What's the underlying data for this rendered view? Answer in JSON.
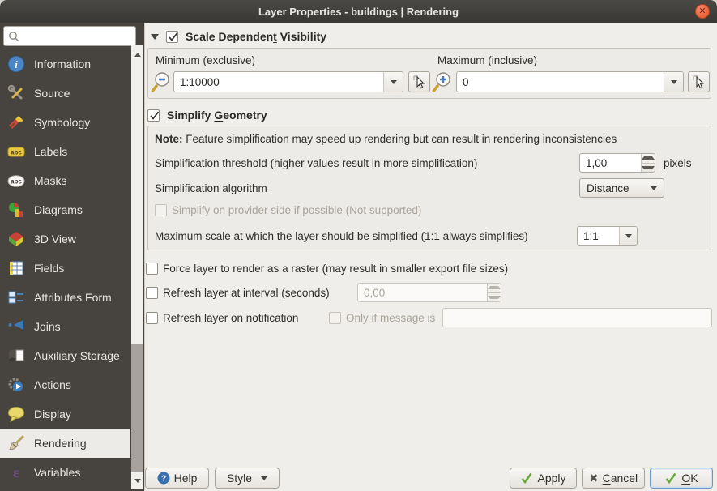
{
  "window": {
    "title": "Layer Properties - buildings | Rendering"
  },
  "colors": {
    "titlebar": "#403e3a",
    "sidebar_bg": "#474440",
    "sidebar_selected": "#edebe7",
    "panel_bg": "#f0eeeb",
    "close_button": "#e8643a",
    "check_green": "#67a73c",
    "info_blue": "#4a86c8"
  },
  "sidebar": {
    "search_value": "",
    "items": [
      {
        "label": "Information",
        "icon": "information-icon"
      },
      {
        "label": "Source",
        "icon": "source-icon"
      },
      {
        "label": "Symbology",
        "icon": "symbology-icon"
      },
      {
        "label": "Labels",
        "icon": "labels-icon"
      },
      {
        "label": "Masks",
        "icon": "masks-icon"
      },
      {
        "label": "Diagrams",
        "icon": "diagrams-icon"
      },
      {
        "label": "3D View",
        "icon": "3d-view-icon"
      },
      {
        "label": "Fields",
        "icon": "fields-icon"
      },
      {
        "label": "Attributes Form",
        "icon": "attributes-form-icon"
      },
      {
        "label": "Joins",
        "icon": "joins-icon"
      },
      {
        "label": "Auxiliary Storage",
        "icon": "auxiliary-storage-icon"
      },
      {
        "label": "Actions",
        "icon": "actions-icon"
      },
      {
        "label": "Display",
        "icon": "display-icon"
      },
      {
        "label": "Rendering",
        "icon": "rendering-icon",
        "selected": true
      },
      {
        "label": "Variables",
        "icon": "variables-icon"
      }
    ]
  },
  "scale_section": {
    "title_pre": "Scale Dependen",
    "title_mn": "t",
    "title_post": " Visibility",
    "checked": true,
    "min_label": "Minimum (exclusive)",
    "max_label": "Maximum (inclusive)",
    "min_value": "1:10000",
    "max_value": "0"
  },
  "simplify_section": {
    "title_pre": "Simplify ",
    "title_mn": "G",
    "title_post": "eometry",
    "checked": true,
    "note_bold": "Note:",
    "note_text": " Feature simplification may speed up rendering but can result in rendering inconsistencies",
    "threshold_label": "Simplification threshold (higher values result in more simplification)",
    "threshold_value": "1,00",
    "threshold_unit": "pixels",
    "algorithm_label": "Simplification algorithm",
    "algorithm_value": "Distance",
    "provider_label": "Simplify on provider side if possible (Not supported)",
    "max_scale_label": "Maximum scale at which the layer should be simplified (1:1 always simplifies)",
    "max_scale_value": "1:1"
  },
  "options": {
    "force_raster": "Force layer to render as a raster (may result in smaller export file sizes)",
    "refresh_interval_label": "Refresh layer at interval (seconds)",
    "refresh_interval_value": "0,00",
    "refresh_notification_label": "Refresh layer on notification",
    "only_message_label": "Only if message is",
    "notification_value": ""
  },
  "footer": {
    "help_label": "Help",
    "style_label": "Style",
    "apply_label": "Apply",
    "cancel_mn": "C",
    "cancel_post": "ancel",
    "ok_mn": "O",
    "ok_post": "K"
  }
}
